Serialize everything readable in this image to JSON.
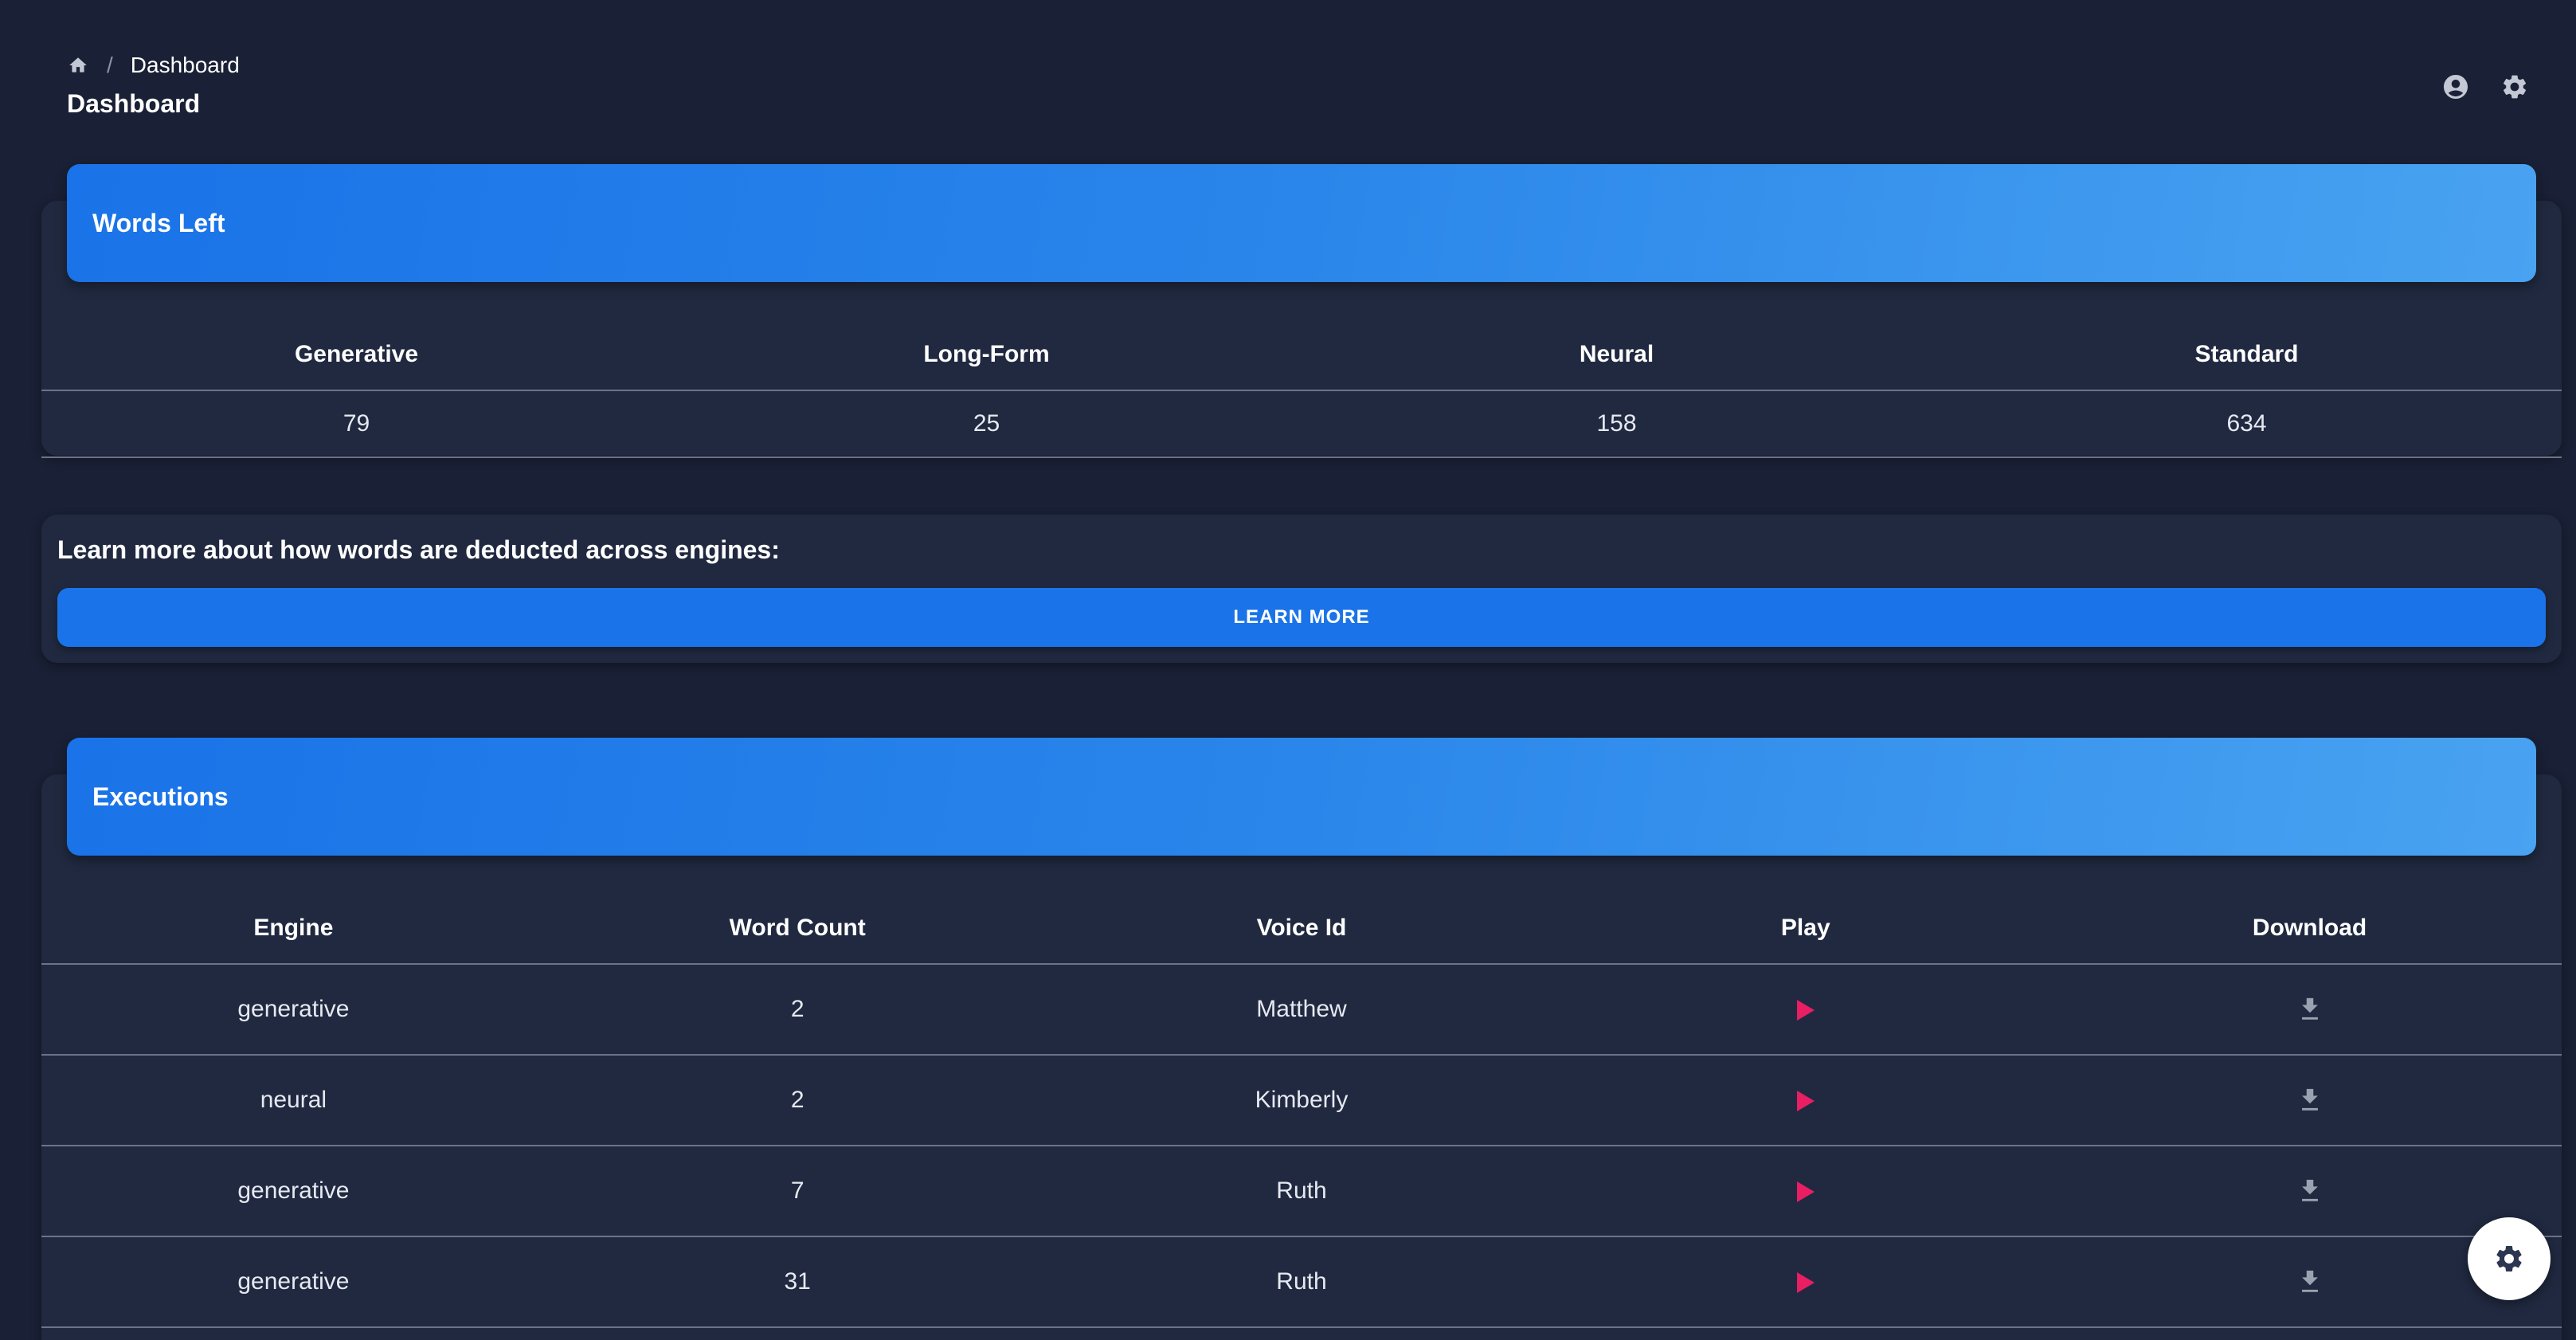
{
  "breadcrumb": {
    "current": "Dashboard",
    "separator": "/",
    "home_icon": "home-icon"
  },
  "page": {
    "title": "Dashboard"
  },
  "top_actions": {
    "account_icon": "account-circle-icon",
    "settings_icon": "gear-icon"
  },
  "words_left": {
    "title": "Words Left",
    "columns": [
      "Generative",
      "Long-Form",
      "Neural",
      "Standard"
    ],
    "values": [
      "79",
      "25",
      "158",
      "634"
    ]
  },
  "learn_more": {
    "text": "Learn more about how words are deducted across engines:",
    "button_label": "LEARN MORE"
  },
  "executions": {
    "title": "Executions",
    "columns": [
      "Engine",
      "Word Count",
      "Voice Id",
      "Play",
      "Download"
    ],
    "rows": [
      {
        "engine": "generative",
        "word_count": "2",
        "voice_id": "Matthew"
      },
      {
        "engine": "neural",
        "word_count": "2",
        "voice_id": "Kimberly"
      },
      {
        "engine": "generative",
        "word_count": "7",
        "voice_id": "Ruth"
      },
      {
        "engine": "generative",
        "word_count": "31",
        "voice_id": "Ruth"
      }
    ]
  },
  "colors": {
    "background": "#1a2035",
    "card": "#202940",
    "accent": "#1a73e8",
    "play": "#e91e63"
  },
  "fab": {
    "icon": "gear-icon"
  }
}
